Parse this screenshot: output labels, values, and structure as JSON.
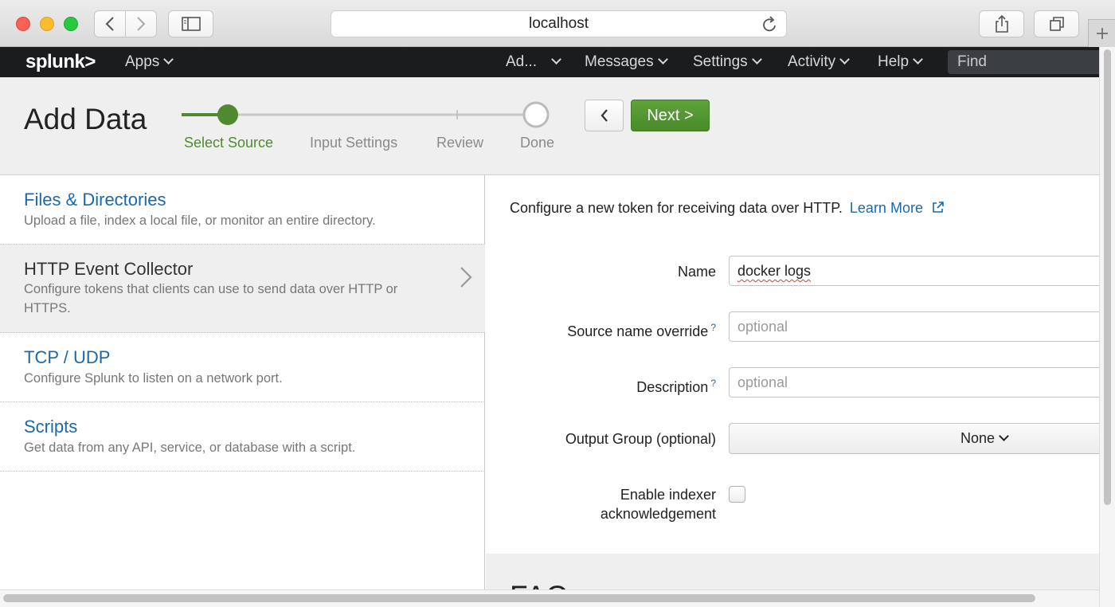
{
  "browser": {
    "url": "localhost",
    "traffic_light_colors": {
      "close": "#fc5f57",
      "minimize": "#fdbc2e",
      "maximize": "#28c840"
    }
  },
  "nav": {
    "logo": "splunk>",
    "apps": "Apps",
    "admin": "Ad...",
    "messages": "Messages",
    "settings": "Settings",
    "activity": "Activity",
    "help": "Help",
    "find_placeholder": "Find"
  },
  "header": {
    "title": "Add Data",
    "steps": [
      {
        "label": "Select Source",
        "state": "active"
      },
      {
        "label": "Input Settings",
        "state": "pending"
      },
      {
        "label": "Review",
        "state": "pending"
      },
      {
        "label": "Done",
        "state": "pending"
      }
    ],
    "back_button": "<",
    "next_button": "Next >",
    "accent_color": "#4f8a2e"
  },
  "sources": [
    {
      "title": "Files & Directories",
      "desc": "Upload a file, index a local file, or monitor an entire directory.",
      "selected": false
    },
    {
      "title": "HTTP Event Collector",
      "desc": "Configure tokens that clients can use to send data over HTTP or HTTPS.",
      "selected": true
    },
    {
      "title": "TCP / UDP",
      "desc": "Configure Splunk to listen on a network port.",
      "selected": false
    },
    {
      "title": "Scripts",
      "desc": "Get data from any API, service, or database with a script.",
      "selected": false
    }
  ],
  "form": {
    "intro": "Configure a new token for receiving data over HTTP.",
    "learn_more": "Learn More",
    "name_label": "Name",
    "name_value": "docker logs",
    "source_label": "Source name override",
    "source_placeholder": "optional",
    "desc_label": "Description",
    "desc_placeholder": "optional",
    "output_label": "Output Group (optional)",
    "output_value": "None",
    "ack_label_1": "Enable indexer",
    "ack_label_2": "acknowledgement",
    "help_mark": "?",
    "faq_heading": "FAQ"
  }
}
